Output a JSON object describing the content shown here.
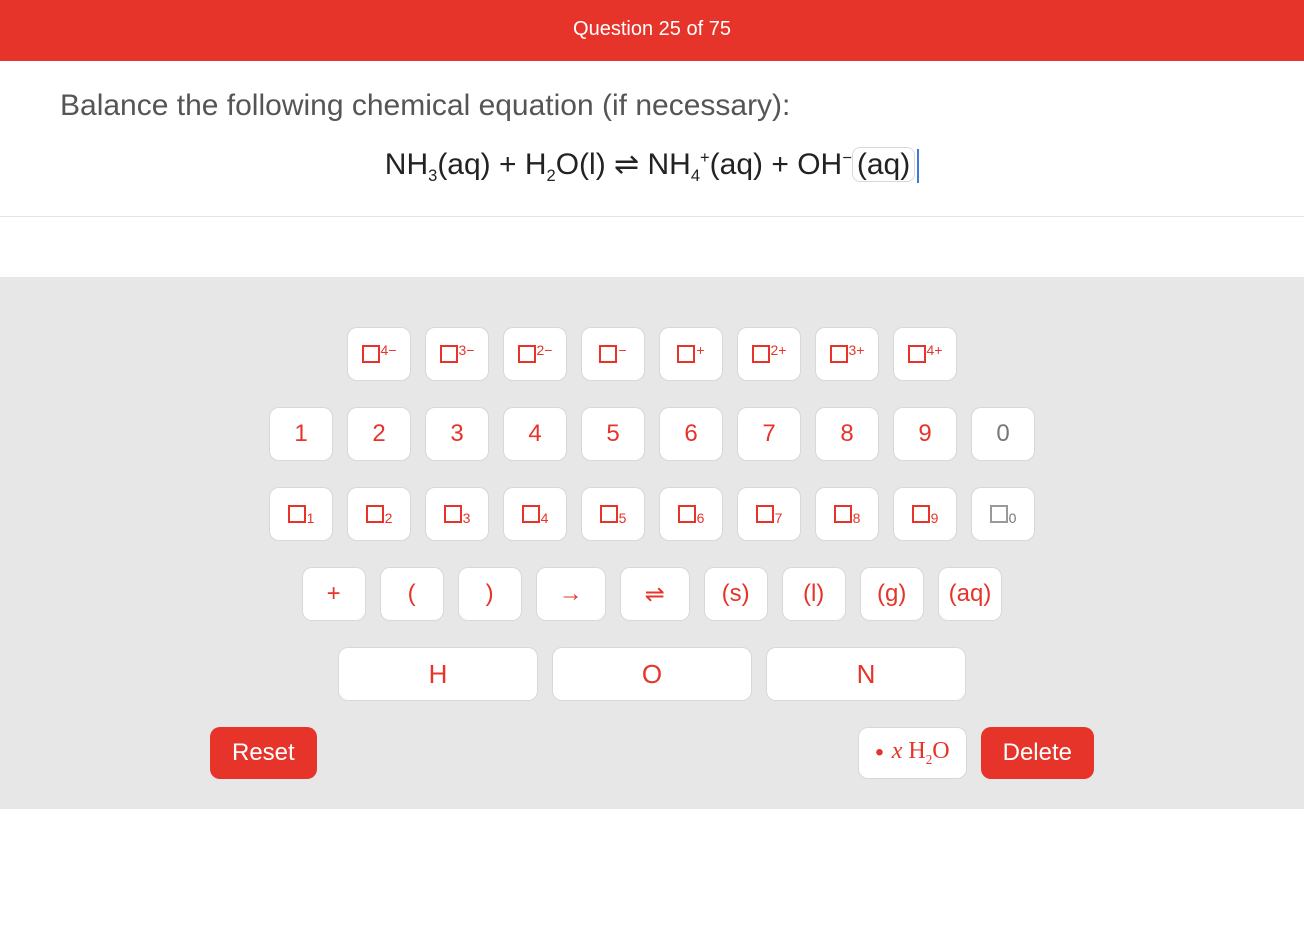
{
  "header": {
    "title": "Question 25 of 75"
  },
  "question": {
    "prompt": "Balance the following chemical equation (if necessary):",
    "equation_plain": "NH3(aq) + H2O(l) ⇌ NH4+(aq) + OH-(aq)"
  },
  "keypad": {
    "charge_row": [
      {
        "id": "charge-4minus",
        "sup": "4−"
      },
      {
        "id": "charge-3minus",
        "sup": "3−"
      },
      {
        "id": "charge-2minus",
        "sup": "2−"
      },
      {
        "id": "charge-minus",
        "sup": "−"
      },
      {
        "id": "charge-plus",
        "sup": "+"
      },
      {
        "id": "charge-2plus",
        "sup": "2+"
      },
      {
        "id": "charge-3plus",
        "sup": "3+"
      },
      {
        "id": "charge-4plus",
        "sup": "4+"
      }
    ],
    "digit_row": [
      "1",
      "2",
      "3",
      "4",
      "5",
      "6",
      "7",
      "8",
      "9",
      "0"
    ],
    "subscript_row": [
      {
        "id": "sub-1",
        "sub": "1"
      },
      {
        "id": "sub-2",
        "sub": "2"
      },
      {
        "id": "sub-3",
        "sub": "3"
      },
      {
        "id": "sub-4",
        "sub": "4"
      },
      {
        "id": "sub-5",
        "sub": "5"
      },
      {
        "id": "sub-6",
        "sub": "6"
      },
      {
        "id": "sub-7",
        "sub": "7"
      },
      {
        "id": "sub-8",
        "sub": "8"
      },
      {
        "id": "sub-9",
        "sub": "9"
      },
      {
        "id": "sub-0",
        "sub": "0",
        "gray": true
      }
    ],
    "symbol_row": {
      "plus": "+",
      "open_paren": "(",
      "close_paren": ")",
      "arrow": "→",
      "equilibrium": "⇌",
      "state_s": "(s)",
      "state_l": "(l)",
      "state_g": "(g)",
      "state_aq": "(aq)"
    },
    "element_row": [
      "H",
      "O",
      "N"
    ],
    "action_row": {
      "reset": "Reset",
      "hydrate_x": "x",
      "hydrate_label_plain": "H2O",
      "delete": "Delete"
    }
  }
}
